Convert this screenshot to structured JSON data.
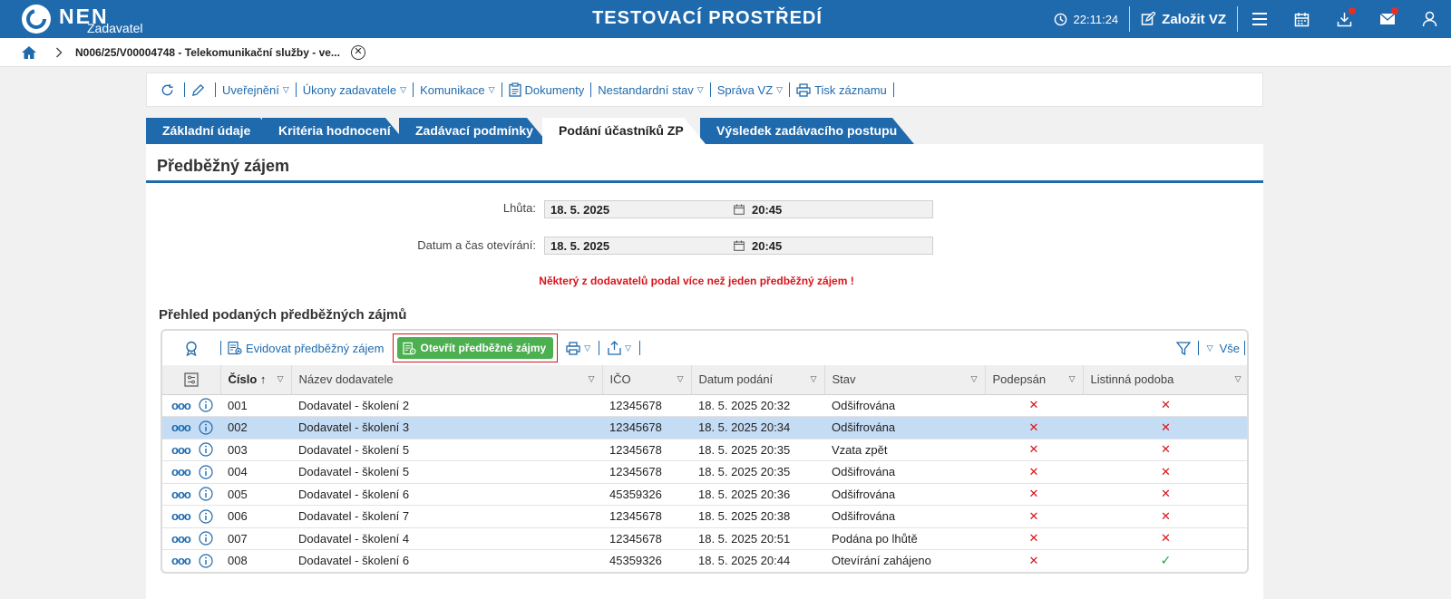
{
  "header": {
    "logo_text": "NEN",
    "logo_sub": "Zadavatel",
    "title": "TESTOVACÍ PROSTŘEDÍ",
    "clock": "22:11:24",
    "new_vz": "Založit VZ",
    "icons": [
      "clock-icon",
      "edit-icon",
      "menu-icon",
      "calendar-icon",
      "download-icon",
      "mail-icon",
      "user-icon"
    ]
  },
  "breadcrumb": {
    "text": "N006/25/V00004748 - Telekomunikační služby - ve..."
  },
  "toolbar": {
    "items": [
      "Uveřejnění",
      "Úkony zadavatele",
      "Komunikace",
      "Dokumenty",
      "Nestandardní stav",
      "Správa VZ",
      "Tisk záznamu"
    ]
  },
  "tabs": [
    "Základní údaje",
    "Kritéria hodnocení",
    "Zadávací podmínky",
    "Podání účastníků ZP",
    "Výsledek zadávacího postupu"
  ],
  "panel": {
    "title": "Předběžný zájem",
    "deadline_label": "Lhůta:",
    "deadline_date": "18. 5. 2025",
    "deadline_time": "20:45",
    "opening_label": "Datum a čas otevírání:",
    "opening_date": "18. 5. 2025",
    "opening_time": "20:45",
    "warning": "Některý z dodavatelů podal více než jeden předběžný zájem !",
    "section_title": "Přehled podaných předběžných zájmů"
  },
  "grid": {
    "evidovat_label": "Evidovat předběžný zájem",
    "open_label": "Otevřít předběžné zájmy",
    "all_label": "Vše",
    "columns": [
      "Číslo",
      "Název dodavatele",
      "IČO",
      "Datum podání",
      "Stav",
      "Podepsán",
      "Listinná podoba"
    ],
    "rows": [
      {
        "cislo": "001",
        "nazev": "Dodavatel - školení 2",
        "ico": "12345678",
        "datum": "18. 5. 2025 20:32",
        "stav": "Odšifrována",
        "podepsan": "✕",
        "listinna": "✕"
      },
      {
        "cislo": "002",
        "nazev": "Dodavatel - školení 3",
        "ico": "12345678",
        "datum": "18. 5. 2025 20:34",
        "stav": "Odšifrována",
        "podepsan": "✕",
        "listinna": "✕"
      },
      {
        "cislo": "003",
        "nazev": "Dodavatel - školení 5",
        "ico": "12345678",
        "datum": "18. 5. 2025 20:35",
        "stav": "Vzata zpět",
        "podepsan": "✕",
        "listinna": "✕"
      },
      {
        "cislo": "004",
        "nazev": "Dodavatel - školení 5",
        "ico": "12345678",
        "datum": "18. 5. 2025 20:35",
        "stav": "Odšifrována",
        "podepsan": "✕",
        "listinna": "✕"
      },
      {
        "cislo": "005",
        "nazev": "Dodavatel - školení 6",
        "ico": "45359326",
        "datum": "18. 5. 2025 20:36",
        "stav": "Odšifrována",
        "podepsan": "✕",
        "listinna": "✕"
      },
      {
        "cislo": "006",
        "nazev": "Dodavatel - školení 7",
        "ico": "12345678",
        "datum": "18. 5. 2025 20:38",
        "stav": "Odšifrována",
        "podepsan": "✕",
        "listinna": "✕"
      },
      {
        "cislo": "007",
        "nazev": "Dodavatel - školení 4",
        "ico": "12345678",
        "datum": "18. 5. 2025 20:51",
        "stav": "Podána po lhůtě",
        "podepsan": "✕",
        "listinna": "✕"
      },
      {
        "cislo": "008",
        "nazev": "Dodavatel - školení 6",
        "ico": "45359326",
        "datum": "18. 5. 2025 20:44",
        "stav": "Otevírání zahájeno",
        "podepsan": "✕",
        "listinna": "✓"
      }
    ]
  }
}
